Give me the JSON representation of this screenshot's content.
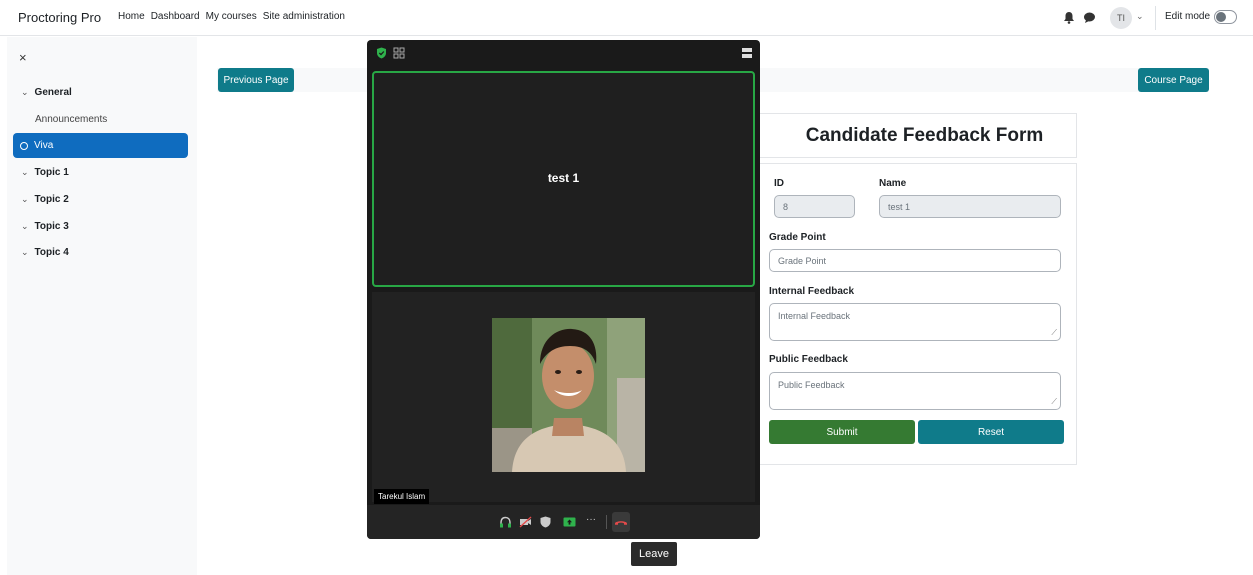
{
  "navbar": {
    "brand": "Proctoring Pro",
    "links": [
      "Home",
      "Dashboard",
      "My courses",
      "Site administration"
    ],
    "avatar_initials": "TI",
    "edit_mode_label": "Edit mode",
    "edit_mode_on": false
  },
  "drawer": {
    "close_label": "×",
    "sections": [
      {
        "label": "General",
        "items": [
          "Announcements",
          "Viva"
        ]
      },
      {
        "label": "Topic 1"
      },
      {
        "label": "Topic 2"
      },
      {
        "label": "Topic 3"
      },
      {
        "label": "Topic 4"
      }
    ],
    "active_item": "Viva"
  },
  "page_nav": {
    "previous_label": "Previous Page",
    "course_label": "Course Page"
  },
  "form": {
    "title": "Candidate Feedback Form",
    "id_label": "ID",
    "id_value": "8",
    "name_label": "Name",
    "name_value": "test 1",
    "grade_label": "Grade Point",
    "grade_placeholder": "Grade Point",
    "internal_label": "Internal Feedback",
    "internal_placeholder": "Internal Feedback",
    "public_label": "Public Feedback",
    "public_placeholder": "Public Feedback",
    "submit_label": "Submit",
    "reset_label": "Reset"
  },
  "call": {
    "active_participant": "test 1",
    "self_name": "Tarekul Islam",
    "tooltip": "Leave",
    "more_label": "···"
  },
  "colors": {
    "primary_blue": "#0f6cbf",
    "teal": "#0f7b8a",
    "green": "#357a32",
    "active_border": "#28a745",
    "leave_red": "#e34a4a"
  }
}
